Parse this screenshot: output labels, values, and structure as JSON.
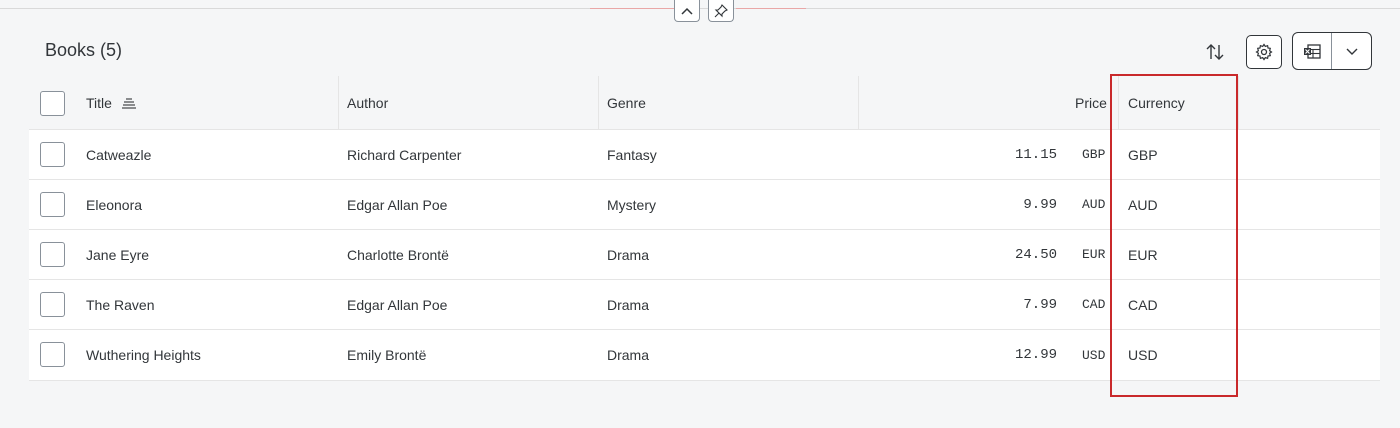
{
  "toolbar": {
    "title": "Books (5)"
  },
  "table": {
    "columns": {
      "title": "Title",
      "author": "Author",
      "genre": "Genre",
      "price": "Price",
      "currency": "Currency"
    },
    "rows": [
      {
        "title": "Catweazle",
        "author": "Richard Carpenter",
        "genre": "Fantasy",
        "price": "11.15",
        "unit": "GBP",
        "currency": "GBP"
      },
      {
        "title": "Eleonora",
        "author": "Edgar Allan Poe",
        "genre": "Mystery",
        "price": "9.99",
        "unit": "AUD",
        "currency": "AUD"
      },
      {
        "title": "Jane Eyre",
        "author": "Charlotte Brontë",
        "genre": "Drama",
        "price": "24.50",
        "unit": "EUR",
        "currency": "EUR"
      },
      {
        "title": "The Raven",
        "author": "Edgar Allan Poe",
        "genre": "Drama",
        "price": "7.99",
        "unit": "CAD",
        "currency": "CAD"
      },
      {
        "title": "Wuthering Heights",
        "author": "Emily Brontë",
        "genre": "Drama",
        "price": "12.99",
        "unit": "USD",
        "currency": "USD"
      }
    ]
  },
  "icons": {
    "collapse": "chevron-up-icon",
    "pin": "pin-icon",
    "sort": "sort-icon",
    "settings": "gear-icon",
    "export": "spreadsheet-export-icon",
    "export_menu": "chevron-down-icon",
    "title_sorted": "sort-ascending-icon"
  },
  "colors": {
    "highlight": "#c9292b",
    "text": "#32363a",
    "header_bg": "#f5f6f7"
  }
}
